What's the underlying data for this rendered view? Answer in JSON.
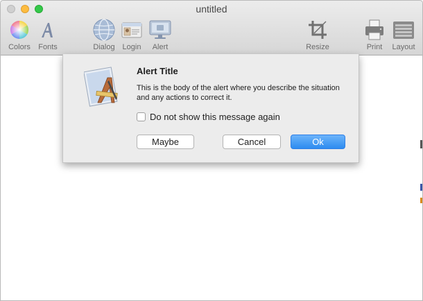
{
  "window": {
    "title": "untitled"
  },
  "toolbar": {
    "colors_label": "Colors",
    "fonts_label": "Fonts",
    "dialog_label": "Dialog",
    "login_label": "Login",
    "alert_label": "Alert",
    "resize_label": "Resize",
    "print_label": "Print",
    "layout_label": "Layout"
  },
  "alert": {
    "title": "Alert Title",
    "body": "This is the body of the alert where you describe the situation and any actions to correct it.",
    "checkbox_label": "Do not show this message again",
    "checkbox_checked": false,
    "buttons": {
      "maybe": "Maybe",
      "cancel": "Cancel",
      "ok": "Ok"
    }
  },
  "icons": {
    "colors": "color-wheel-icon",
    "fonts": "font-letter-a-icon",
    "dialog": "globe-icon",
    "login": "id-card-icon",
    "alert": "monitor-icon",
    "resize": "crop-icon",
    "print": "printer-icon",
    "layout": "layout-icon",
    "alert_app": "app-pencil-ruler-icon"
  },
  "colors": {
    "accent": "#2d8cf0",
    "close": "#d0d0d0",
    "minimize": "#fdbc40",
    "maximize": "#34c84a"
  }
}
